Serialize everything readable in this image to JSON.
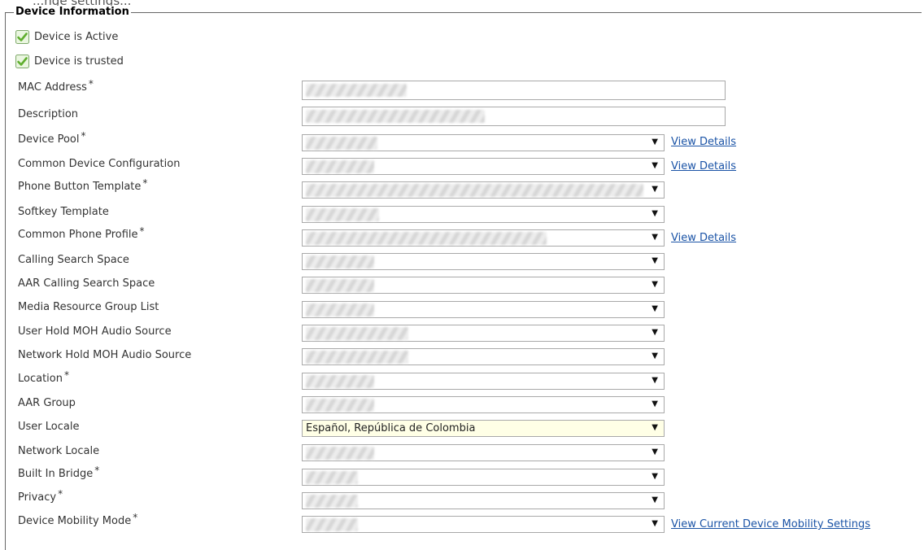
{
  "top_fragment": "...nge settings...",
  "section": {
    "title": "Device Information"
  },
  "checkboxes": [
    {
      "label": "Device is Active",
      "checked": true
    },
    {
      "label": "Device is trusted",
      "checked": true
    }
  ],
  "required_marker": "*",
  "fields": {
    "mac_address": {
      "label": "MAC Address",
      "required": true
    },
    "description": {
      "label": "Description",
      "required": false
    },
    "device_pool": {
      "label": "Device Pool",
      "required": true,
      "link": "View Details"
    },
    "common_device_configuration": {
      "label": "Common Device Configuration",
      "required": false,
      "link": "View Details"
    },
    "phone_button_template": {
      "label": "Phone Button Template",
      "required": true
    },
    "softkey_template": {
      "label": "Softkey Template",
      "required": false
    },
    "common_phone_profile": {
      "label": "Common Phone Profile",
      "required": true,
      "link": "View Details"
    },
    "calling_search_space": {
      "label": "Calling Search Space",
      "required": false
    },
    "aar_calling_search_space": {
      "label": "AAR Calling Search Space",
      "required": false
    },
    "media_resource_group_list": {
      "label": "Media Resource Group List",
      "required": false
    },
    "user_hold_moh_audio_source": {
      "label": "User Hold MOH Audio Source",
      "required": false
    },
    "network_hold_moh_audio_source": {
      "label": "Network Hold MOH Audio Source",
      "required": false
    },
    "location": {
      "label": "Location",
      "required": true
    },
    "aar_group": {
      "label": "AAR Group",
      "required": false
    },
    "user_locale": {
      "label": "User Locale",
      "required": false,
      "value": "Español, República de Colombia"
    },
    "network_locale": {
      "label": "Network Locale",
      "required": false
    },
    "built_in_bridge": {
      "label": "Built In Bridge",
      "required": true
    },
    "privacy": {
      "label": "Privacy",
      "required": true
    },
    "device_mobility_mode": {
      "label": "Device Mobility Mode",
      "required": true,
      "link": "View Current Device Mobility Settings"
    }
  },
  "colors": {
    "link": "#1a53a6",
    "locale_bg": "#ffffe6",
    "check_green": "#5fae2e"
  }
}
